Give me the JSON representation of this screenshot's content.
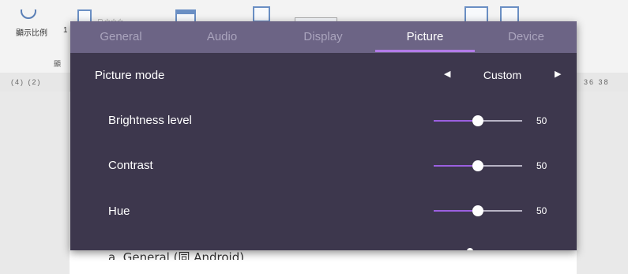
{
  "background_document": {
    "ribbon_text": "顯示比例",
    "ribbon_digit": "1",
    "ribbon_sub_label": "顯",
    "box_text_1": "□ ☆☆☆",
    "box_text_4": "⬚ 📋 ☆ ☆☆ ☆",
    "ruler_left": "(4) (2)",
    "ruler_right": "36 38",
    "body_text": "a. General (同 Android)"
  },
  "dialog": {
    "tabs": [
      {
        "label": "General"
      },
      {
        "label": "Audio"
      },
      {
        "label": "Display"
      },
      {
        "label": "Picture"
      },
      {
        "label": "Device"
      }
    ],
    "active_tab": "Picture",
    "picture_mode": {
      "label": "Picture mode",
      "value": "Custom",
      "prev_icon": "◀",
      "next_icon": "▶"
    },
    "settings": [
      {
        "label": "Brightness level",
        "value": "50",
        "fraction": 0.5
      },
      {
        "label": "Contrast",
        "value": "50",
        "fraction": 0.5
      },
      {
        "label": "Hue",
        "value": "50",
        "fraction": 0.5
      }
    ]
  },
  "colors": {
    "tabbar": "#6c6485",
    "dialog": "#3d374d",
    "accent": "#9b5fe0",
    "active_tab_underline": "#b27be8"
  }
}
